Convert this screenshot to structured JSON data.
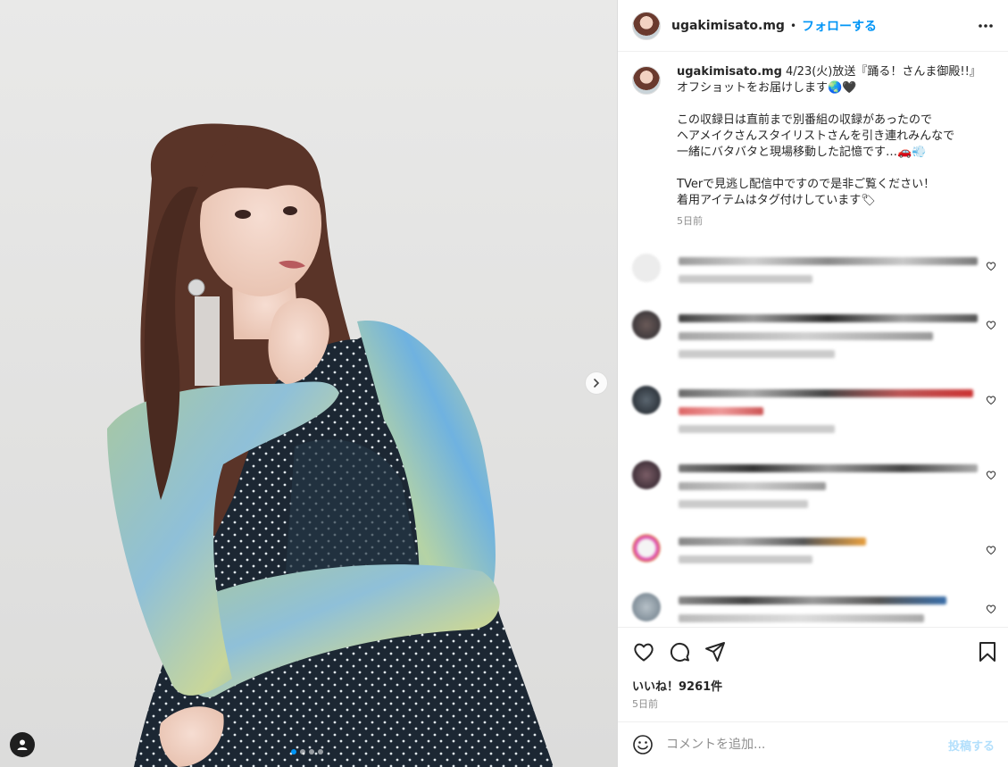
{
  "post": {
    "username": "ugakimisato.mg",
    "separator": "•",
    "follow_label": "フォローする",
    "more_icon": "more-horizontal-icon"
  },
  "caption": {
    "username": "ugakimisato.mg",
    "lines": [
      " 4/23(火)放送『踊る！さんま御殿!!』",
      "オフショットをお届けします🌏🖤",
      "",
      "この収録日は直前まで別番組の収録があったので",
      "ヘアメイクさんスタイリストさんを引き連れみんなで",
      "一緒にバタバタと現場移動した記憶です…🚗💨",
      "",
      "TVerで見逃し配信中ですので是非ご覧ください！",
      "着用アイテムはタグ付けしています🏷"
    ],
    "time": "5日前"
  },
  "actions": {
    "like_icon": "heart-icon",
    "comment_icon": "comment-icon",
    "share_icon": "share-icon",
    "save_icon": "bookmark-icon"
  },
  "likes_text": "いいね！9261件",
  "post_time": "5日前",
  "add_comment": {
    "placeholder": "コメントを追加...",
    "post_label": "投稿する",
    "emoji_icon": "emoji-icon"
  },
  "carousel": {
    "total": 4,
    "active": 1
  },
  "colors": {
    "accent": "#0095f6",
    "post_disabled": "#b2dffc",
    "muted": "#8e8e8e"
  }
}
